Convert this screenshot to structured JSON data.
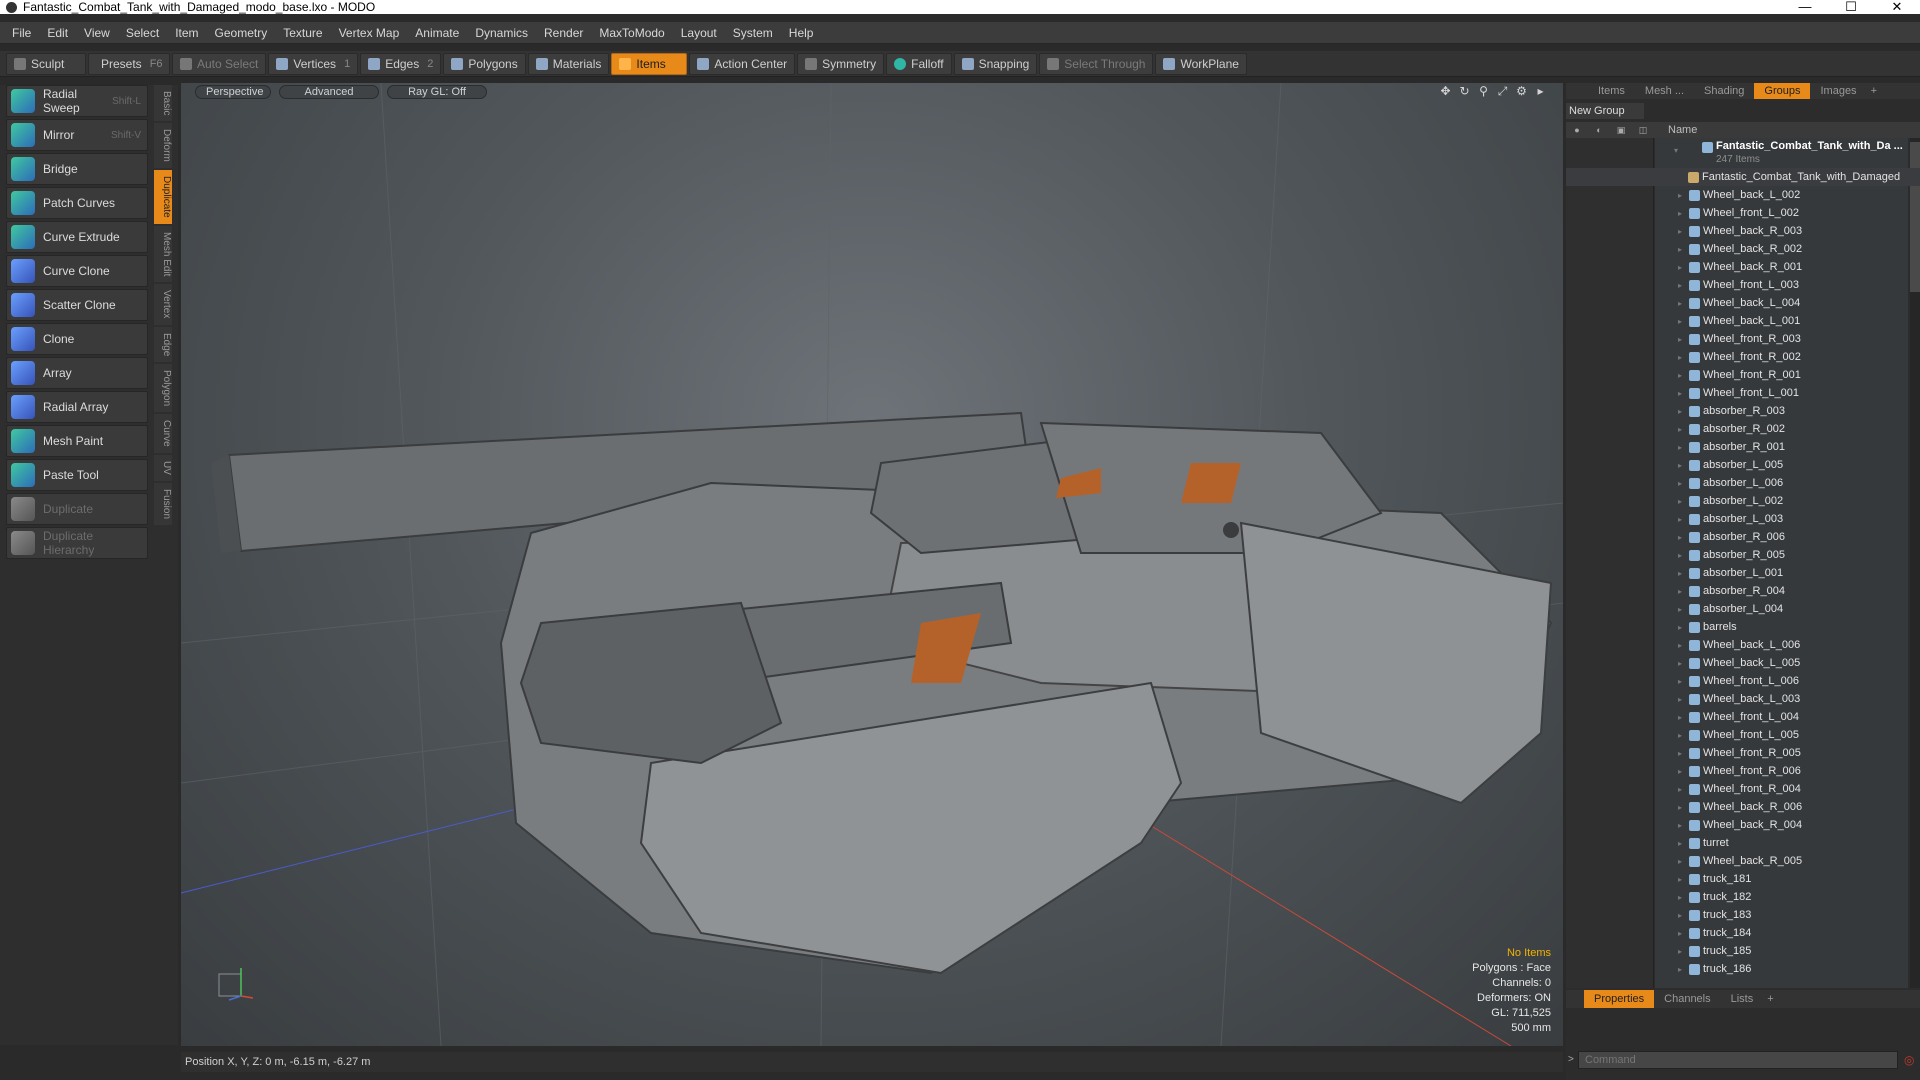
{
  "window": {
    "title": "Fantastic_Combat_Tank_with_Damaged_modo_base.lxo - MODO",
    "minimize": "—",
    "maximize": "☐",
    "close": "✕"
  },
  "menu": [
    "File",
    "Edit",
    "View",
    "Select",
    "Item",
    "Geometry",
    "Texture",
    "Vertex Map",
    "Animate",
    "Dynamics",
    "Render",
    "MaxToModo",
    "Layout",
    "System",
    "Help"
  ],
  "toolbar": {
    "sculpt": "Sculpt",
    "presets": "Presets",
    "presets_key": "F6",
    "auto_select": "Auto Select",
    "vertices": "Vertices",
    "vertices_count": "1",
    "edges": "Edges",
    "edges_count": "2",
    "polygons": "Polygons",
    "materials": "Materials",
    "items": "Items",
    "action_center": "Action Center",
    "symmetry": "Symmetry",
    "falloff": "Falloff",
    "snapping": "Snapping",
    "select_through": "Select Through",
    "workplane": "WorkPlane"
  },
  "tools": [
    {
      "label": "Radial Sweep",
      "shortcut": "Shift-L"
    },
    {
      "label": "Mirror",
      "shortcut": "Shift-V"
    },
    {
      "label": "Bridge",
      "shortcut": ""
    },
    {
      "label": "Patch Curves",
      "shortcut": ""
    },
    {
      "label": "Curve Extrude",
      "shortcut": ""
    },
    {
      "label": "Curve Clone",
      "shortcut": ""
    },
    {
      "label": "Scatter Clone",
      "shortcut": ""
    },
    {
      "label": "Clone",
      "shortcut": ""
    },
    {
      "label": "Array",
      "shortcut": ""
    },
    {
      "label": "Radial Array",
      "shortcut": ""
    },
    {
      "label": "Mesh Paint",
      "shortcut": ""
    },
    {
      "label": "Paste Tool",
      "shortcut": ""
    },
    {
      "label": "Duplicate",
      "shortcut": ""
    },
    {
      "label": "Duplicate Hierarchy",
      "shortcut": ""
    }
  ],
  "vtabs": [
    "Basic",
    "Deform",
    "Duplicate",
    "Mesh Edit",
    "Vertex",
    "Edge",
    "Polygon",
    "Curve",
    "UV",
    "Fusion"
  ],
  "viewport": {
    "view": "Perspective",
    "shading": "Advanced",
    "raygl": "Ray GL: Off",
    "info": {
      "items": "No Items",
      "polygons": "Polygons : Face",
      "channels": "Channels: 0",
      "deformers": "Deformers: ON",
      "gl": "GL: 711,525",
      "scale": "500 mm"
    }
  },
  "status": {
    "position": "Position X, Y, Z:  0 m, -6.15 m, -6.27 m"
  },
  "right_panel": {
    "tabs": [
      "Items",
      "Mesh ...",
      "Shading",
      "Groups",
      "Images",
      "+"
    ],
    "new_group": "New Group",
    "name_header": "Name",
    "root": {
      "name": "Fantastic_Combat_Tank_with_Da ...",
      "count": "247 Items"
    },
    "mesh": "Fantastic_Combat_Tank_with_Damaged",
    "items": [
      "Wheel_back_L_002",
      "Wheel_front_L_002",
      "Wheel_back_R_003",
      "Wheel_back_R_002",
      "Wheel_back_R_001",
      "Wheel_front_L_003",
      "Wheel_back_L_004",
      "Wheel_back_L_001",
      "Wheel_front_R_003",
      "Wheel_front_R_002",
      "Wheel_front_R_001",
      "Wheel_front_L_001",
      "absorber_R_003",
      "absorber_R_002",
      "absorber_R_001",
      "absorber_L_005",
      "absorber_L_006",
      "absorber_L_002",
      "absorber_L_003",
      "absorber_R_006",
      "absorber_R_005",
      "absorber_L_001",
      "absorber_R_004",
      "absorber_L_004",
      "barrels",
      "Wheel_back_L_006",
      "Wheel_back_L_005",
      "Wheel_front_L_006",
      "Wheel_back_L_003",
      "Wheel_front_L_004",
      "Wheel_front_L_005",
      "Wheel_front_R_005",
      "Wheel_front_R_006",
      "Wheel_front_R_004",
      "Wheel_back_R_006",
      "Wheel_back_R_004",
      "turret",
      "Wheel_back_R_005",
      "truck_181",
      "truck_182",
      "truck_183",
      "truck_184",
      "truck_185",
      "truck_186"
    ],
    "bottom_tabs": [
      "Properties",
      "Channels",
      "Lists",
      "+"
    ],
    "command_placeholder": "Command"
  }
}
